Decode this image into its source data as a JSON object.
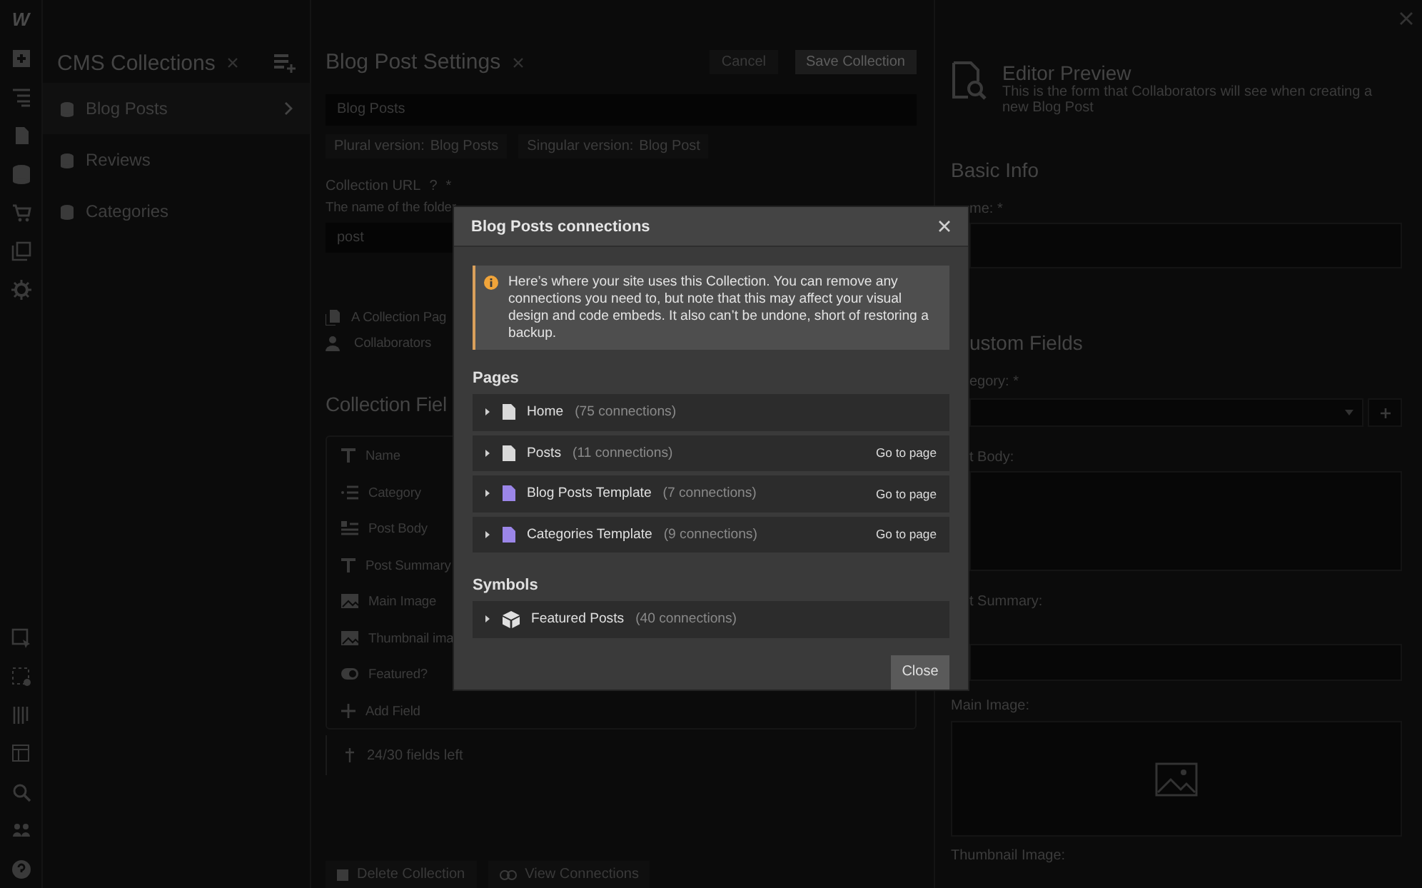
{
  "app": {
    "logo": "W"
  },
  "collections": {
    "title": "CMS Collections",
    "items": [
      {
        "name": "Blog Posts",
        "selected": true
      },
      {
        "name": "Reviews",
        "selected": false
      },
      {
        "name": "Categories",
        "selected": false
      }
    ]
  },
  "settings": {
    "title": "Blog Post Settings",
    "cancel": "Cancel",
    "save": "Save Collection",
    "name_value": "Blog Posts",
    "plural_label": "Plural version:",
    "plural_value": "Blog Posts",
    "singular_label": "Singular version:",
    "singular_value": "Blog Post",
    "url_label": "Collection URL",
    "url_help": "?",
    "url_required": "*",
    "url_description": "The name of the folder",
    "url_value": "post",
    "links": [
      {
        "kind": "pages",
        "label": "A Collection Pag"
      },
      {
        "kind": "people",
        "label": "Collaborators"
      }
    ],
    "fields_title": "Collection Fiel",
    "fields": [
      {
        "kind": "text",
        "name": "Name"
      },
      {
        "kind": "option",
        "name": "Category"
      },
      {
        "kind": "richtext",
        "name": "Post Body"
      },
      {
        "kind": "text",
        "name": "Post Summary"
      },
      {
        "kind": "image",
        "name": "Main Image"
      },
      {
        "kind": "image",
        "name": "Thumbnail ima"
      },
      {
        "kind": "switch",
        "name": "Featured?"
      },
      {
        "kind": "add",
        "name": "Add Field"
      }
    ],
    "fields_left": "24/30 fields left",
    "delete": "Delete Collection",
    "view": "View Connections"
  },
  "preview": {
    "title": "Editor Preview",
    "description": "This is the form that Collaborators will see when creating a new Blog Post",
    "basic_info": "Basic Info",
    "name_label": "me: *",
    "custom_fields": "ustom Fields",
    "category_label": "egory: *",
    "body_label": "t Body:",
    "summary_label": "t Summary:",
    "main_image_label": "Main Image:",
    "thumbnail_label": "Thumbnail Image:"
  },
  "modal": {
    "title": "Blog Posts connections",
    "notice": "Here’s where your site uses this Collection. You can remove any connections you need to, but note that this may affect your visual design and code embeds. It also can’t be undone, short of restoring a backup.",
    "sections": [
      {
        "heading": "Pages",
        "items": [
          {
            "kind": "page",
            "name": "Home",
            "count": "(75 connections)"
          },
          {
            "kind": "page",
            "name": "Posts",
            "count": "(11 connections)",
            "action": "Go to page"
          },
          {
            "kind": "template",
            "name": "Blog Posts Template",
            "count": "(7 connections)",
            "action": "Go to page"
          },
          {
            "kind": "template",
            "name": "Categories Template",
            "count": "(9 connections)",
            "action": "Go to page"
          }
        ]
      },
      {
        "heading": "Symbols",
        "items": [
          {
            "kind": "symbol",
            "name": "Featured Posts",
            "count": "(40 connections)"
          }
        ]
      }
    ],
    "close": "Close"
  }
}
